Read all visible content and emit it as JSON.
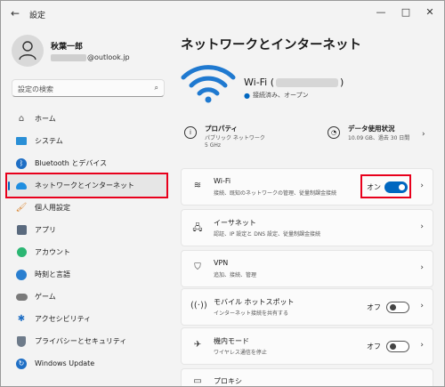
{
  "window": {
    "title": "設定",
    "back": "←",
    "minimize": "—",
    "maximize": "□",
    "close": "✕"
  },
  "user": {
    "name": "秋葉一郎",
    "email_suffix": "@outlook.jp"
  },
  "search": {
    "placeholder": "設定の検索"
  },
  "nav": {
    "items": [
      {
        "label": "ホーム"
      },
      {
        "label": "システム"
      },
      {
        "label": "Bluetooth とデバイス"
      },
      {
        "label": "ネットワークとインターネット"
      },
      {
        "label": "個人用設定"
      },
      {
        "label": "アプリ"
      },
      {
        "label": "アカウント"
      },
      {
        "label": "時刻と言語"
      },
      {
        "label": "ゲーム"
      },
      {
        "label": "アクセシビリティ"
      },
      {
        "label": "プライバシーとセキュリティ"
      },
      {
        "label": "Windows Update"
      }
    ]
  },
  "main": {
    "title": "ネットワークとインターネット",
    "wifi": {
      "name_prefix": "Wi-Fi (",
      "name_suffix": ")",
      "status": "接続済み、オープン"
    },
    "properties": {
      "title": "プロパティ",
      "line1": "パブリック ネットワーク",
      "line2": "5 GHz"
    },
    "data_usage": {
      "title": "データ使用状況",
      "detail": "10.09 GB、過去 30 日間"
    },
    "cards": [
      {
        "title": "Wi-Fi",
        "subtitle": "接続、既知のネットワークの管理、従量制課金接続",
        "toggle_label": "オン"
      },
      {
        "title": "イーサネット",
        "subtitle": "認証、IP 設定と DNS 設定、従量制課金接続"
      },
      {
        "title": "VPN",
        "subtitle": "追加、接続、管理"
      },
      {
        "title": "モバイル ホットスポット",
        "subtitle": "インターネット接続を共有する",
        "toggle_label": "オフ"
      },
      {
        "title": "機内モード",
        "subtitle": "ワイヤレス通信を停止",
        "toggle_label": "オフ"
      },
      {
        "title": "プロキシ"
      }
    ]
  },
  "colors": {
    "accent": "#0067c0",
    "highlight": "#e8001c"
  }
}
